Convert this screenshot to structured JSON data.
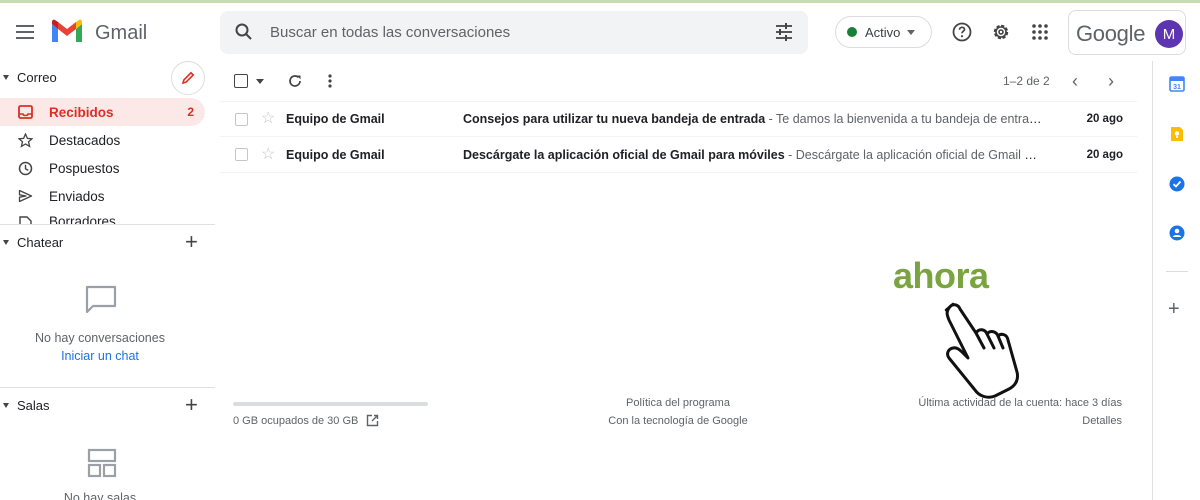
{
  "header": {
    "brand": "Gmail",
    "search_placeholder": "Buscar en todas las conversaciones",
    "status": "Activo",
    "google_word": "Google",
    "avatar_letter": "M"
  },
  "sidebar": {
    "mail_section": "Correo",
    "items": [
      {
        "label": "Recibidos",
        "count": "2",
        "icon": "inbox-icon"
      },
      {
        "label": "Destacados",
        "icon": "star-icon"
      },
      {
        "label": "Pospuestos",
        "icon": "clock-icon"
      },
      {
        "label": "Enviados",
        "icon": "send-icon"
      },
      {
        "label": "Borradores",
        "icon": "draft-icon"
      }
    ],
    "chat_section": "Chatear",
    "chat_empty": "No hay conversaciones",
    "chat_link": "Iniciar un chat",
    "rooms_section": "Salas",
    "rooms_empty": "No hay salas"
  },
  "toolbar": {
    "pager": "1–2 de 2"
  },
  "emails": [
    {
      "sender": "Equipo de Gmail",
      "subject": "Consejos para utilizar tu nueva bandeja de entrada",
      "snippet": " - Te damos la bienvenida a tu bandeja de entrad…",
      "date": "20 ago"
    },
    {
      "sender": "Equipo de Gmail",
      "subject": "Descárgate la aplicación oficial de Gmail para móviles",
      "snippet": " - Descárgate la aplicación oficial de Gmail pa…",
      "date": "20 ago"
    }
  ],
  "footer": {
    "storage": "0 GB ocupados de 30 GB",
    "storage_fraction": 0.0,
    "policy": "Política del programa",
    "powered": "Con la tecnología de Google",
    "last_activity": "Última actividad de la cuenta: hace 3 días",
    "details": "Detalles"
  },
  "overlay": {
    "caption": "ahora"
  },
  "colors": {
    "accent_red": "#d93025",
    "active_bg": "#fce8e6",
    "link_blue": "#1a73e8",
    "status_green": "#188038",
    "avatar": "#5e35b1",
    "caption_green": "#7aa43f"
  }
}
